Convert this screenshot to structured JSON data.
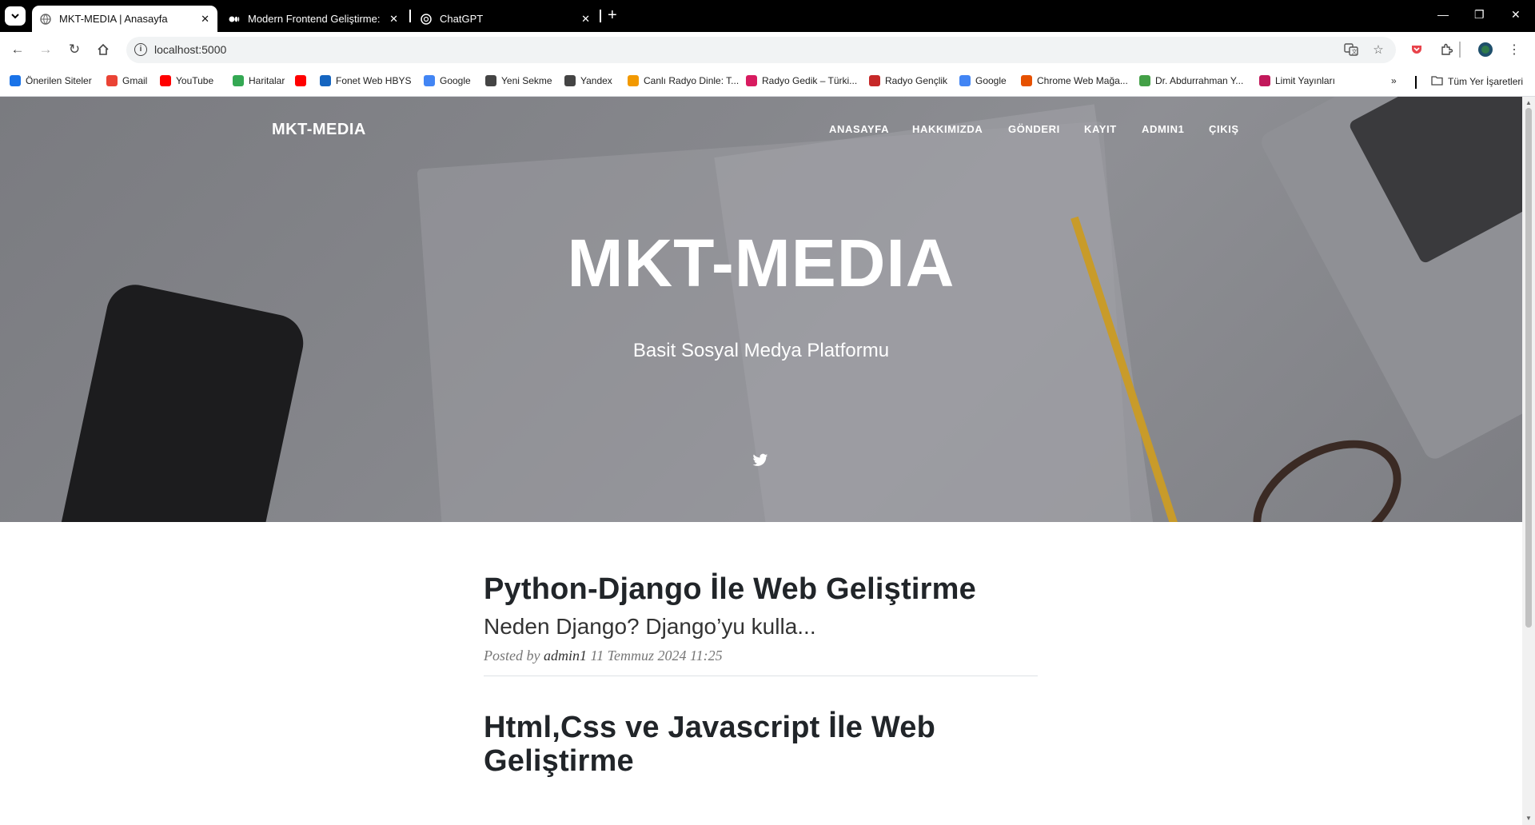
{
  "browser": {
    "tabs": [
      {
        "title": "MKT-MEDIA | Anasayfa",
        "active": true
      },
      {
        "title": "Modern Frontend Geliştirme: H",
        "active": false
      },
      {
        "title": "ChatGPT",
        "active": false
      }
    ],
    "address": "localhost:5000",
    "bookmarks": [
      {
        "label": "Önerilen Siteler",
        "icon": "search-icon",
        "color": "#1a73e8"
      },
      {
        "label": "Gmail",
        "icon": "gmail-icon",
        "color": "#ea4335"
      },
      {
        "label": "YouTube",
        "icon": "youtube-icon",
        "color": "#ff0000"
      },
      {
        "label": "Haritalar",
        "icon": "maps-icon",
        "color": "#34a853"
      },
      {
        "label": "",
        "icon": "youtube-icon",
        "color": "#ff0000"
      },
      {
        "label": "Fonet Web HBYS",
        "icon": "fonet-icon",
        "color": "#1565c0"
      },
      {
        "label": "Google",
        "icon": "google-icon",
        "color": "#4285f4"
      },
      {
        "label": "Yeni Sekme",
        "icon": "globe-icon",
        "color": "#444444"
      },
      {
        "label": "Yandex",
        "icon": "globe-icon",
        "color": "#444444"
      },
      {
        "label": "Canlı Radyo Dinle: T...",
        "icon": "headphones-icon",
        "color": "#f29900"
      },
      {
        "label": "Radyo Gedik – Türki...",
        "icon": "radio-icon",
        "color": "#d81b60"
      },
      {
        "label": "Radyo Gençlik",
        "icon": "radio-icon",
        "color": "#c62828"
      },
      {
        "label": "Google",
        "icon": "google-icon",
        "color": "#4285f4"
      },
      {
        "label": "Chrome Web Mağa...",
        "icon": "chrome-store-icon",
        "color": "#e65100"
      },
      {
        "label": "Dr. Abdurrahman Y...",
        "icon": "tree-icon",
        "color": "#43a047"
      },
      {
        "label": "Limit Yayınları",
        "icon": "limit-icon",
        "color": "#c2185b"
      }
    ],
    "all_bookmarks": "Tüm Yer İşaretleri"
  },
  "site": {
    "brand": "MKT-MEDIA",
    "nav": [
      "ANASAYFA",
      "HAKKIMIZDA",
      "GÖNDERI",
      "KAYIT",
      "ADMIN1",
      "ÇIKIŞ"
    ],
    "hero_title": "MKT-MEDIA",
    "hero_subtitle": "Basit Sosyal Medya Platformu",
    "posts": [
      {
        "title": "Python-Django İle Web Geliştirme",
        "subtitle": "Neden Django? Django’yu kulla...",
        "posted_by": "Posted by",
        "author": "admin1",
        "date": "11 Temmuz 2024 11:25"
      },
      {
        "title": "Html,Css ve Javascript İle Web Geliştirme"
      }
    ]
  }
}
